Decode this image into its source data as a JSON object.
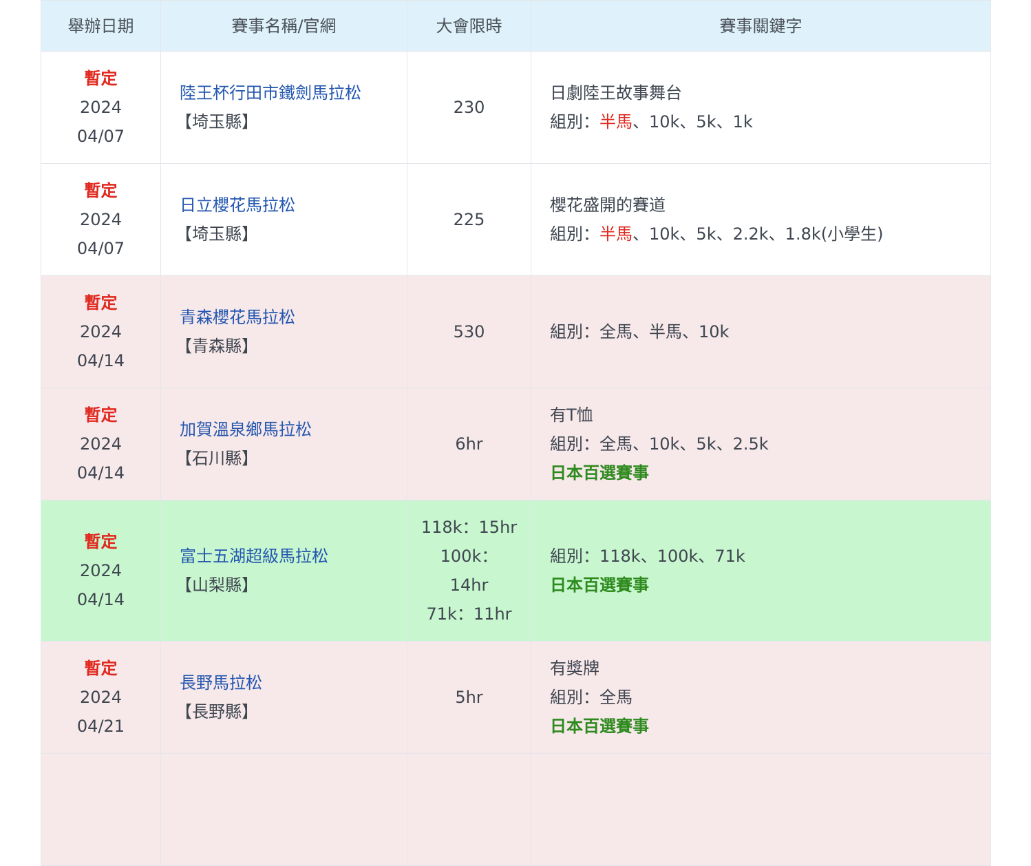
{
  "headers": {
    "date": "舉辦日期",
    "name": "賽事名稱/官網",
    "limit": "大會限時",
    "keywords": "賽事關鍵字"
  },
  "colors": {
    "header_bg": "#dff2fb",
    "row_pink": "#f7e8ea",
    "row_green": "#c8f7cf",
    "link": "#2457b0",
    "status_red": "#e0281e",
    "highlight_green": "#2e8a1e"
  },
  "rows": [
    {
      "status": "暫定",
      "year": "2024",
      "day": "04/07",
      "name": "陸王杯行田市鐵劍馬拉松",
      "pref": "【埼玉縣】",
      "limit": [
        "230"
      ],
      "note": "日劇陸王故事舞台",
      "cat_prefix": "組別：",
      "cat_red": "半馬",
      "cat_rest": "、10k、5k、1k",
      "badge": ""
    },
    {
      "status": "暫定",
      "year": "2024",
      "day": "04/07",
      "name": "日立櫻花馬拉松",
      "pref": "【埼玉縣】",
      "limit": [
        "225"
      ],
      "note": "櫻花盛開的賽道",
      "cat_prefix": "組別：",
      "cat_red": "半馬",
      "cat_rest": "、10k、5k、2.2k、1.8k(小學生)",
      "badge": ""
    },
    {
      "status": "暫定",
      "year": "2024",
      "day": "04/14",
      "name": "青森櫻花馬拉松",
      "pref": "【青森縣】",
      "limit": [
        "530"
      ],
      "note": "",
      "cat_prefix": "組別：",
      "cat_red": "",
      "cat_rest": "全馬、半馬、10k",
      "badge": ""
    },
    {
      "status": "暫定",
      "year": "2024",
      "day": "04/14",
      "name": "加賀溫泉鄉馬拉松",
      "pref": "【石川縣】",
      "limit": [
        "6hr"
      ],
      "note": "有T恤",
      "cat_prefix": "組別：",
      "cat_red": "",
      "cat_rest": "全馬、10k、5k、2.5k",
      "badge": "日本百選賽事"
    },
    {
      "status": "暫定",
      "year": "2024",
      "day": "04/14",
      "name": "富士五湖超級馬拉松",
      "pref": "【山梨縣】",
      "limit": [
        "118k：15hr",
        "100k：",
        "14hr",
        "71k：11hr"
      ],
      "note": "",
      "cat_prefix": "組別：",
      "cat_red": "",
      "cat_rest": "118k、100k、71k",
      "badge": "日本百選賽事"
    },
    {
      "status": "暫定",
      "year": "2024",
      "day": "04/21",
      "name": "長野馬拉松",
      "pref": "【長野縣】",
      "limit": [
        "5hr"
      ],
      "note": "有獎牌",
      "cat_prefix": "組別：",
      "cat_red": "",
      "cat_rest": "全馬",
      "badge": "日本百選賽事"
    }
  ]
}
